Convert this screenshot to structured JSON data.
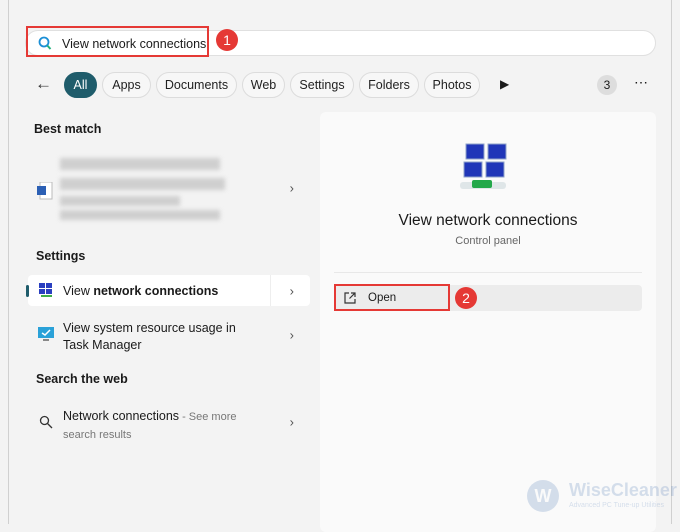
{
  "search": {
    "query": "View network connections",
    "icon": "search-icon"
  },
  "callouts": [
    "1",
    "2"
  ],
  "filters": {
    "back_icon": "arrow-left-icon",
    "chips": [
      "All",
      "Apps",
      "Documents",
      "Web",
      "Settings",
      "Folders",
      "Photos"
    ],
    "more_icon": "play-icon",
    "count": "3",
    "overflow_icon": "ellipsis-icon"
  },
  "left": {
    "best_match_heading": "Best match",
    "settings_heading": "Settings",
    "settings_items": [
      {
        "label_prefix": "View ",
        "label_bold": "network connections"
      },
      {
        "label": "View system resource usage in",
        "label2": "Task Manager"
      }
    ],
    "web_heading": "Search the web",
    "web_item": {
      "label": "Network connections",
      "suffix": " - See more",
      "line2": "search results"
    }
  },
  "detail": {
    "title": "View network connections",
    "subtitle": "Control panel",
    "open_label": "Open"
  },
  "watermark": {
    "brand": "WiseCleaner",
    "tagline": "Advanced PC Tune-up Utilities"
  },
  "colors": {
    "accent": "#1f5c6b",
    "callout": "#e53935"
  }
}
